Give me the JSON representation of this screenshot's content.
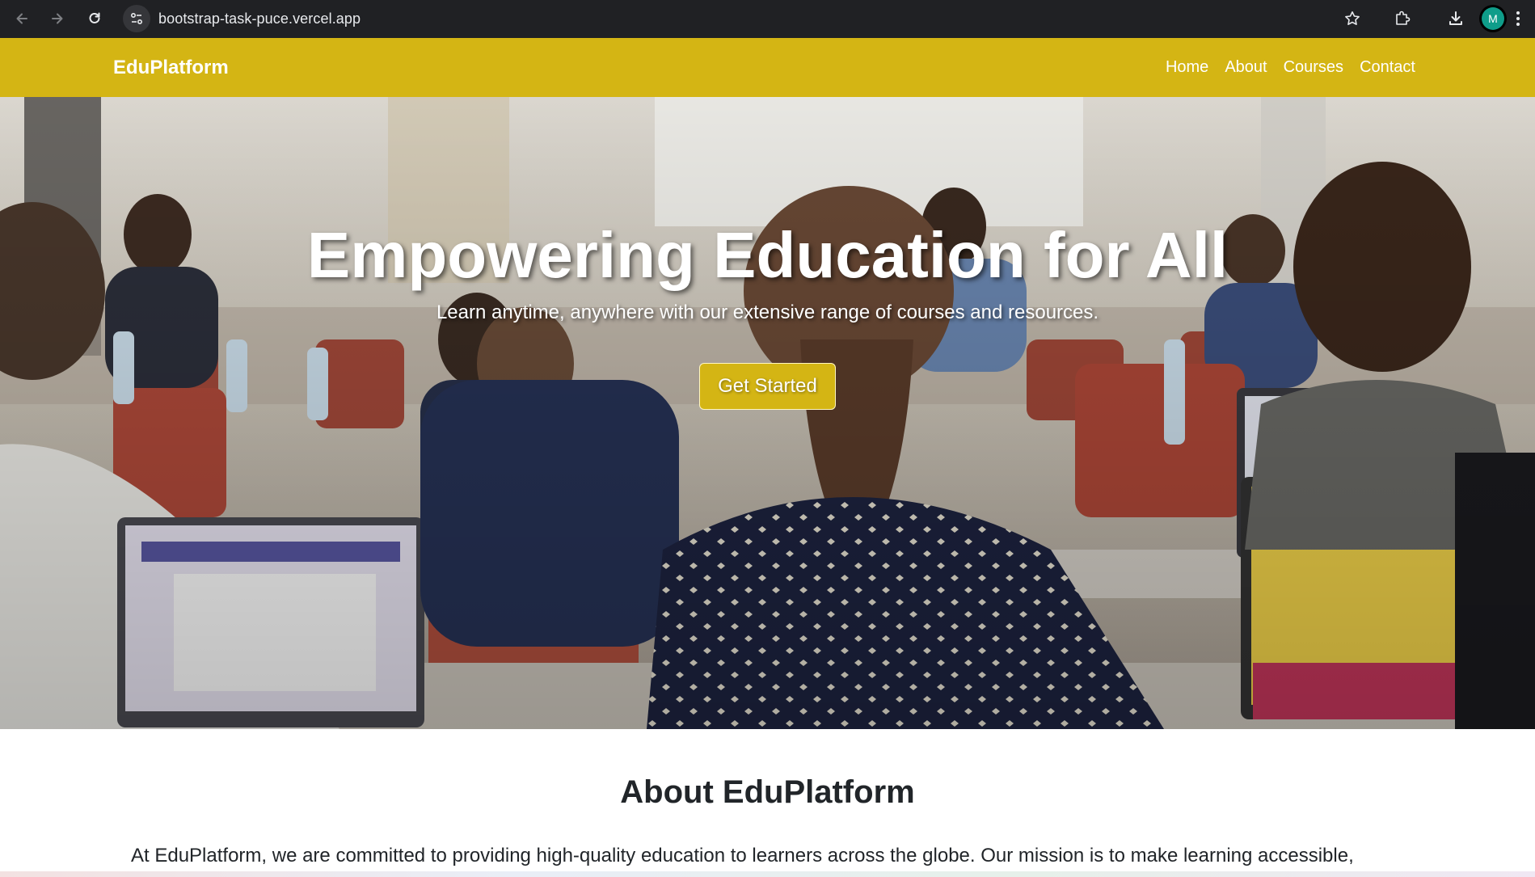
{
  "browser": {
    "url": "bootstrap-task-puce.vercel.app",
    "profile_initial": "M"
  },
  "navbar": {
    "brand": "EduPlatform",
    "links": [
      "Home",
      "About",
      "Courses",
      "Contact"
    ],
    "background_color": "#d4b514"
  },
  "hero": {
    "title": "Empowering Education for All",
    "subtitle": "Learn anytime, anywhere with our extensive range of courses and resources.",
    "cta_label": "Get Started"
  },
  "about": {
    "title": "About EduPlatform",
    "text": "At EduPlatform, we are committed to providing high-quality education to learners across the globe. Our mission is to make learning accessible,"
  },
  "icons": [
    "back-arrow-icon",
    "forward-arrow-icon",
    "reload-icon",
    "site-info-icon",
    "bookmark-star-icon",
    "extensions-icon",
    "download-icon"
  ]
}
